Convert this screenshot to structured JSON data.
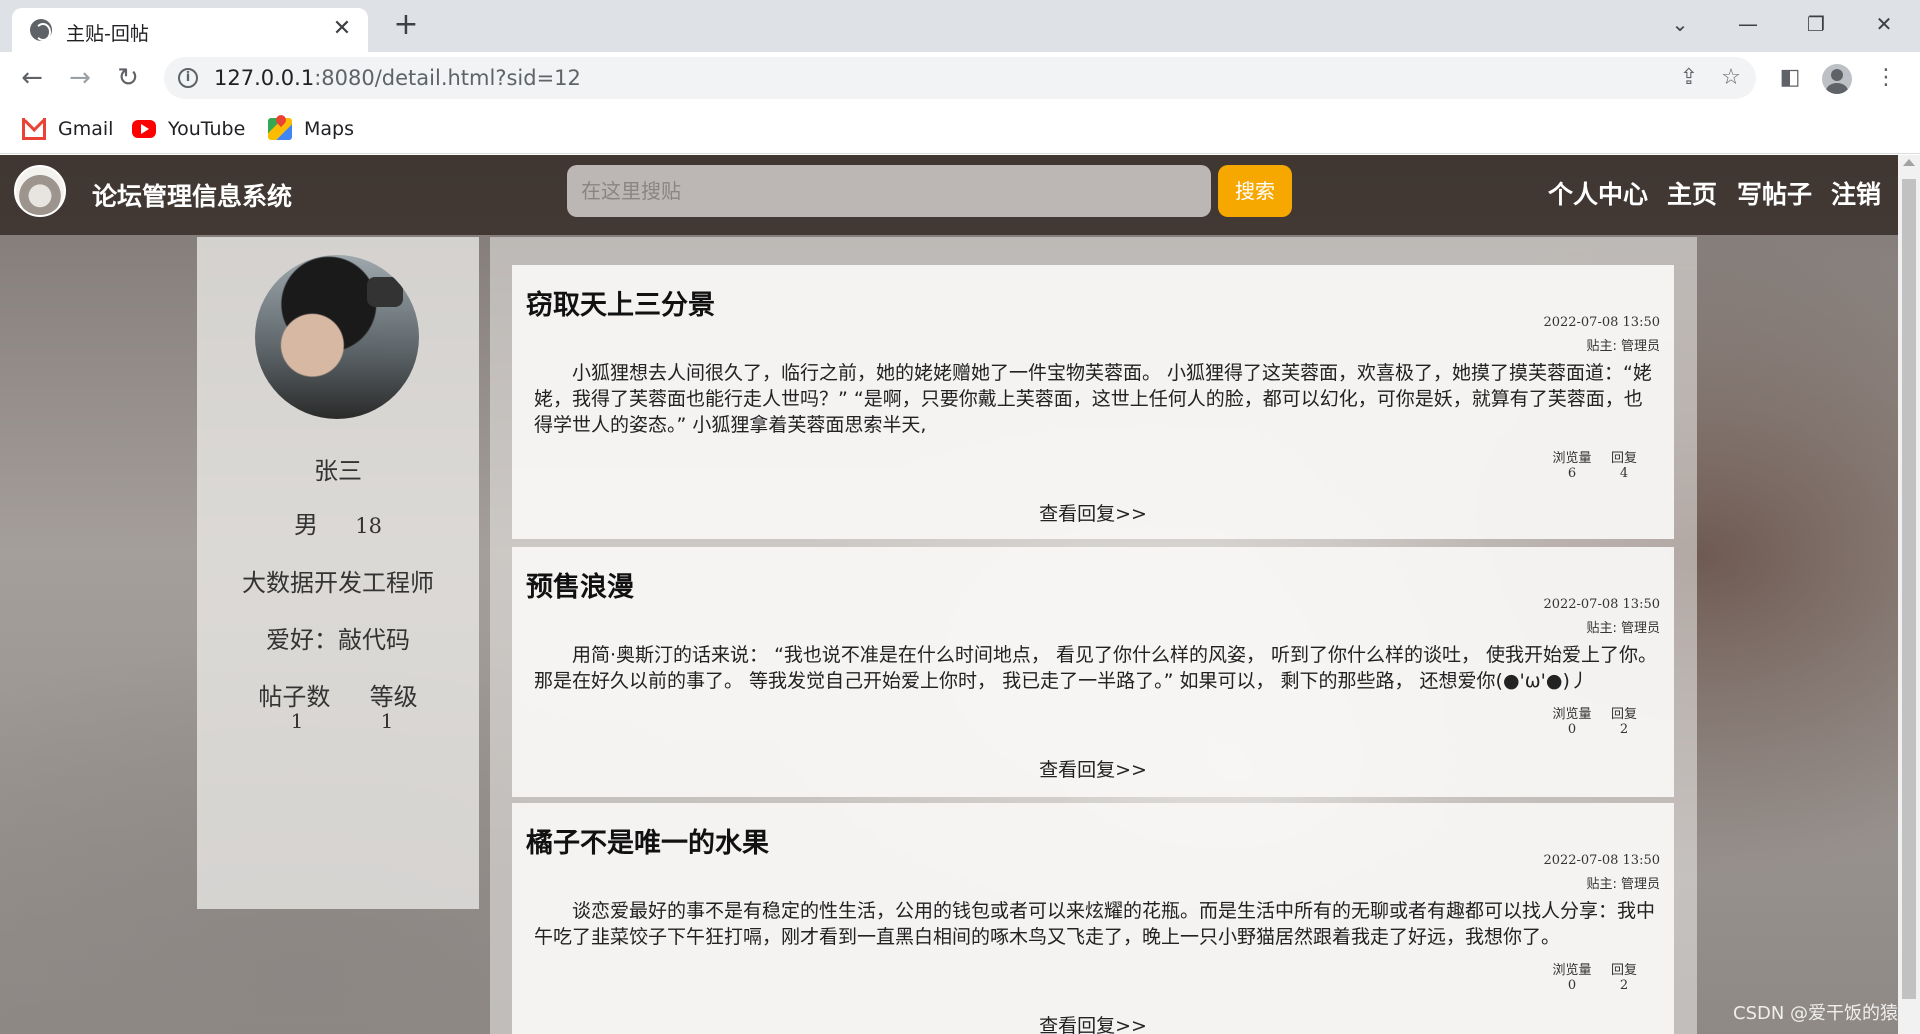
{
  "browser": {
    "tab_title": "主贴-回帖",
    "url_host": "127.0.0.1",
    "url_rest": ":8080/detail.html?sid=12",
    "bookmarks": [
      {
        "label": "Gmail",
        "icon": "gmail-icon"
      },
      {
        "label": "YouTube",
        "icon": "youtube-icon"
      },
      {
        "label": "Maps",
        "icon": "maps-icon"
      }
    ]
  },
  "header": {
    "title": "论坛管理信息系统",
    "search_placeholder": "在这里搜贴",
    "search_button": "搜索",
    "nav": [
      "个人中心",
      "主页",
      "写帖子",
      "注销"
    ]
  },
  "profile": {
    "name": "张三",
    "gender": "男",
    "age": "18",
    "job": "大数据开发工程师",
    "hobby": "爱好：敲代码",
    "posts_label": "帖子数",
    "posts_value": "1",
    "level_label": "等级",
    "level_value": "1"
  },
  "posts": [
    {
      "title": "窃取天上三分景",
      "date": "2022-07-08 13:50",
      "author": "贴主: 管理员",
      "body": "小狐狸想去人间很久了，临行之前，她的姥姥赠她了一件宝物芙蓉面。 小狐狸得了这芙蓉面，欢喜极了，她摸了摸芙蓉面道：“姥姥，我得了芙蓉面也能行走人世吗？” “是啊，只要你戴上芙蓉面，这世上任何人的脸，都可以幻化，可你是妖，就算有了芙蓉面，也得学世人的姿态。” 小狐狸拿着芙蓉面思索半天,",
      "views_label": "浏览量",
      "views": "6",
      "replies_label": "回复",
      "replies": "4",
      "view_replies": "查看回复>>"
    },
    {
      "title": "预售浪漫",
      "date": "2022-07-08 13:50",
      "author": "贴主: 管理员",
      "body": "用简·奥斯汀的话来说： “我也说不准是在什么时间地点， 看见了你什么样的风姿， 听到了你什么样的谈吐， 使我开始爱上了你。 那是在好久以前的事了。 等我发觉自己开始爱上你时， 我已走了一半路了。” 如果可以， 剩下的那些路， 还想爱你(●'ω'●)丿",
      "views_label": "浏览量",
      "views": "0",
      "replies_label": "回复",
      "replies": "2",
      "view_replies": "查看回复>>"
    },
    {
      "title": "橘子不是唯一的水果",
      "date": "2022-07-08 13:50",
      "author": "贴主: 管理员",
      "body": "谈恋爱最好的事不是有稳定的性生活，公用的钱包或者可以来炫耀的花瓶。而是生活中所有的无聊或者有趣都可以找人分享：我中午吃了韭菜饺子下午狂打嗝，刚才看到一直黑白相间的啄木鸟又飞走了，晚上一只小野猫居然跟着我走了好远，我想你了。",
      "views_label": "浏览量",
      "views": "0",
      "replies_label": "回复",
      "replies": "2",
      "view_replies": "查看回复>>"
    }
  ],
  "watermark": "CSDN @爱干饭的猿"
}
